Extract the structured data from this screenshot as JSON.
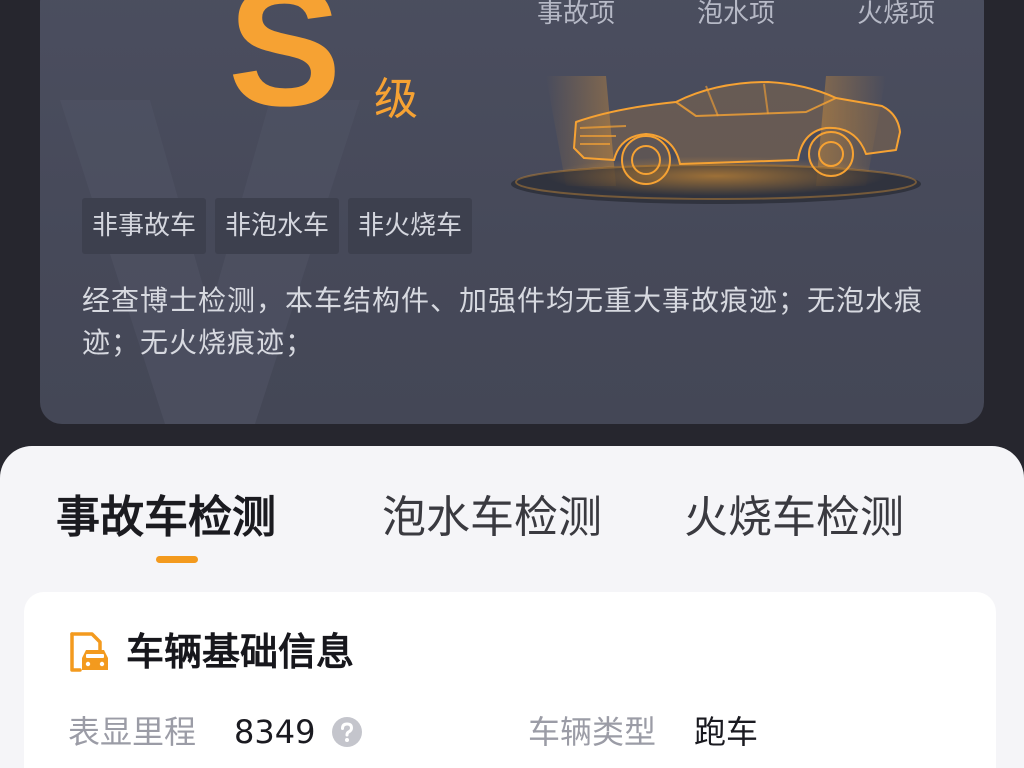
{
  "report": {
    "grade": "S",
    "grade_suffix": "级",
    "categories": [
      "事故项",
      "泡水项",
      "火烧项"
    ],
    "tags": [
      "非事故车",
      "非泡水车",
      "非火烧车"
    ],
    "summary": "经查博士检测，本车结构件、加强件均无重大事故痕迹；无泡水痕迹；无火烧痕迹；",
    "accent_color": "#f6a233"
  },
  "tabs": [
    {
      "label": "事故车检测",
      "active": true
    },
    {
      "label": "泡水车检测",
      "active": false
    },
    {
      "label": "火烧车检测",
      "active": false
    }
  ],
  "vehicle_info": {
    "title": "车辆基础信息",
    "icon": "car-document-icon",
    "fields": [
      {
        "label": "表显里程",
        "value": "8349",
        "icon": "help-icon"
      },
      {
        "label": "车辆类型",
        "value": "跑车"
      }
    ]
  }
}
